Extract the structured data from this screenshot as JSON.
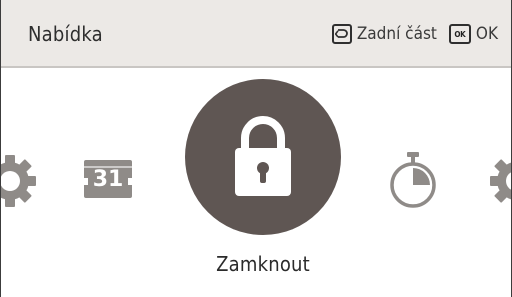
{
  "header": {
    "title": "Nabídka",
    "back_label": "Zadní část",
    "ok_key_label": "OK",
    "ok_label": "OK"
  },
  "carousel": {
    "items": [
      {
        "name": "settings",
        "icon": "gear-icon"
      },
      {
        "name": "calendar",
        "icon": "calendar-icon",
        "day": "31"
      },
      {
        "name": "lock",
        "icon": "lock-icon",
        "label": "Zamknout",
        "selected": true
      },
      {
        "name": "timer",
        "icon": "stopwatch-icon"
      },
      {
        "name": "settings",
        "icon": "gear-icon"
      }
    ]
  },
  "colors": {
    "header_bg": "#ece9e6",
    "focus_circle": "#5f5653",
    "icon_gray": "#8f8b88"
  }
}
